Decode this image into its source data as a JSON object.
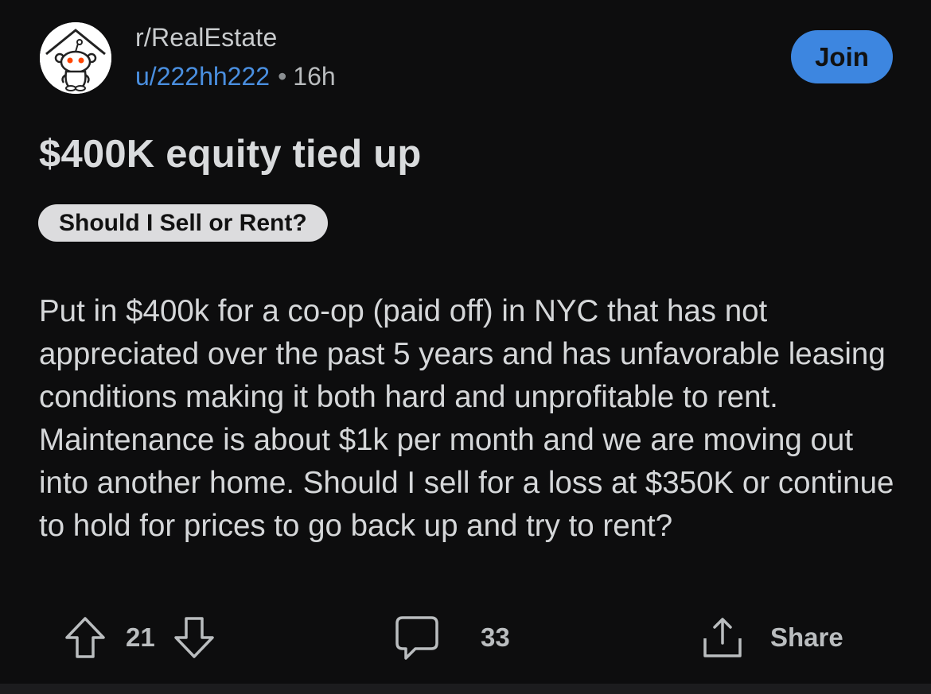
{
  "post": {
    "subreddit": "r/RealEstate",
    "author": "u/222hh222",
    "separator": "•",
    "age": "16h",
    "join_label": "Join",
    "title": "$400K equity tied up",
    "flair": "Should I Sell or Rent?",
    "body": "Put in $400k for a co-op (paid off) in NYC that has not appreciated over the past 5 years and has unfavorable leasing conditions making it both hard and unprofitable to rent. Maintenance is about $1k per month and we are moving out into another home. Should I sell for a loss at $350K or continue to hold for prices to go back up and try to rent?"
  },
  "actions": {
    "upvote_icon": "arrow-up-icon",
    "vote_count": "21",
    "downvote_icon": "arrow-down-icon",
    "comment_icon": "speech-bubble-icon",
    "comment_count": "33",
    "share_icon": "share-icon",
    "share_label": "Share"
  },
  "colors": {
    "background": "#0d0d0e",
    "accent_blue": "#3d86e0",
    "username_blue": "#4a8fe0",
    "flair_bg": "#dcdcde"
  }
}
